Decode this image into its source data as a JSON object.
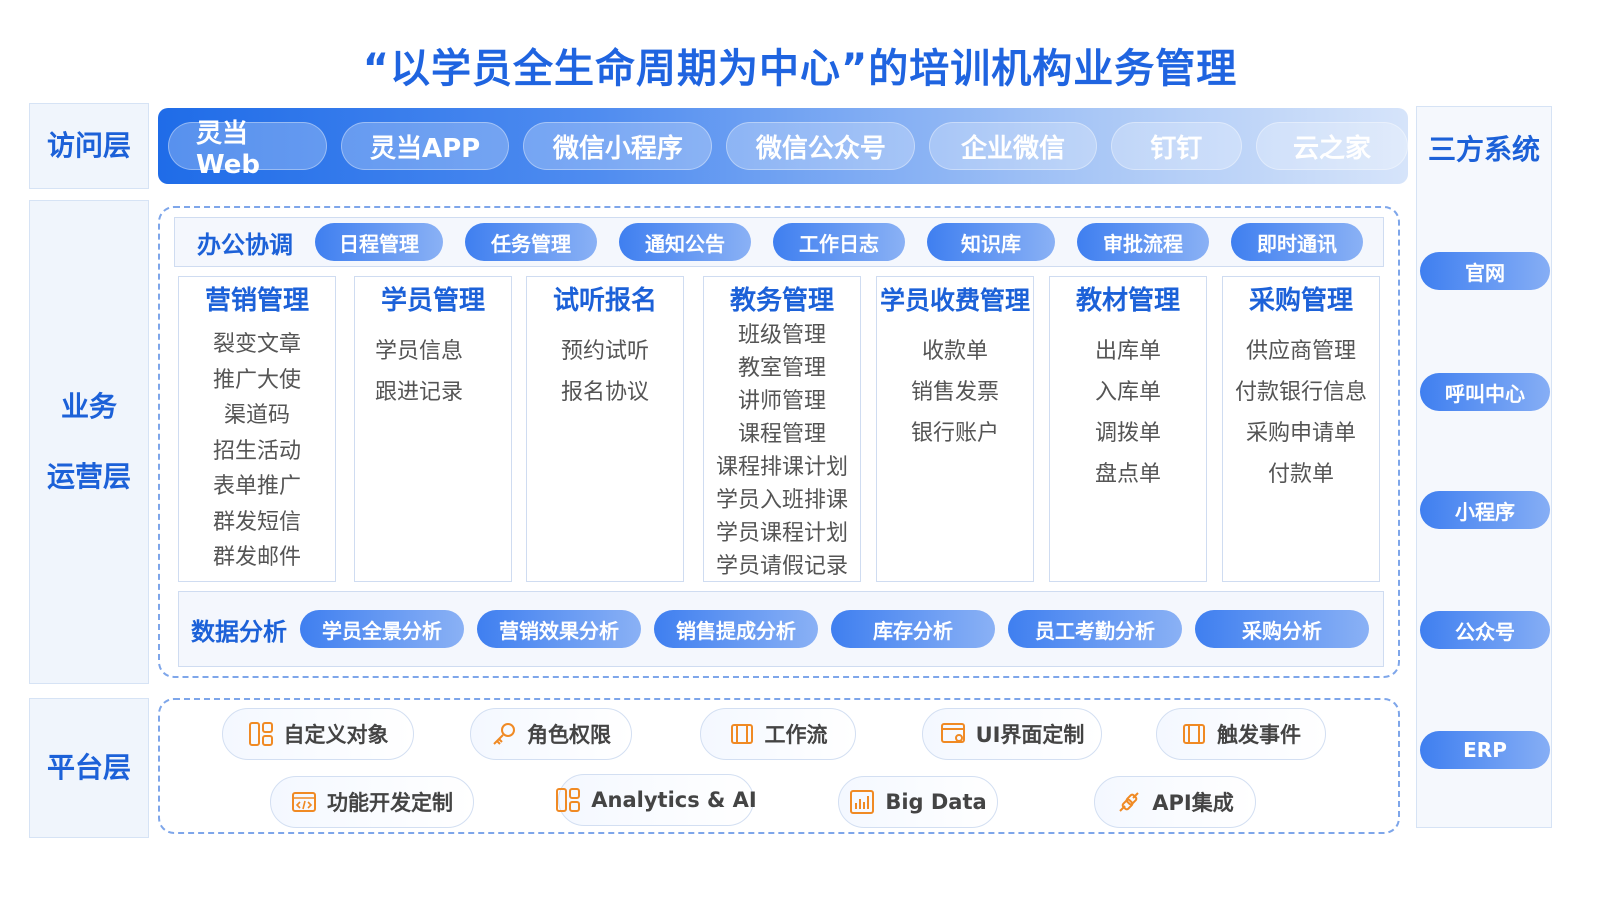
{
  "title": "“以学员全生命周期为中心”的培训机构业务管理",
  "layers": {
    "access": "访问层",
    "business_1": "业务",
    "business_2": "运营层",
    "platform": "平台层"
  },
  "access_items": [
    "灵当Web",
    "灵当APP",
    "微信小程序",
    "微信公众号",
    "企业微信",
    "钉钉",
    "云之家"
  ],
  "office": {
    "title": "办公协调",
    "items": [
      "日程管理",
      "任务管理",
      "通知公告",
      "工作日志",
      "知识库",
      "审批流程",
      "即时通讯"
    ]
  },
  "modules": [
    {
      "title": "营销管理",
      "items": [
        "裂变文章",
        "推广大使",
        "渠道码",
        "招生活动",
        "表单推广",
        "群发短信",
        "群发邮件"
      ]
    },
    {
      "title": "学员管理",
      "items": [
        "学员信息",
        "跟进记录"
      ]
    },
    {
      "title": "试听报名",
      "items": [
        "预约试听",
        "报名协议"
      ]
    },
    {
      "title": "教务管理",
      "items": [
        "班级管理",
        "教室管理",
        "讲师管理",
        "课程管理",
        "课程排课计划",
        "学员入班排课",
        "学员课程计划",
        "学员请假记录"
      ]
    },
    {
      "title": "学员收费管理",
      "items": [
        "收款单",
        "销售发票",
        "银行账户"
      ]
    },
    {
      "title": "教材管理",
      "items": [
        "出库单",
        "入库单",
        "调拨单",
        "盘点单"
      ]
    },
    {
      "title": "采购管理",
      "items": [
        "供应商管理",
        "付款银行信息",
        "采购申请单",
        "付款单"
      ]
    }
  ],
  "analysis": {
    "title": "数据分析",
    "items": [
      "学员全景分析",
      "营销效果分析",
      "销售提成分析",
      "库存分析",
      "员工考勤分析",
      "采购分析"
    ]
  },
  "platform": {
    "row1": [
      {
        "label": "自定义对象",
        "icon": "custom-object-icon"
      },
      {
        "label": "角色权限",
        "icon": "key-icon"
      },
      {
        "label": "工作流",
        "icon": "workflow-icon"
      },
      {
        "label": "UI界面定制",
        "icon": "ui-custom-icon"
      },
      {
        "label": "触发事件",
        "icon": "trigger-icon"
      }
    ],
    "row2": [
      {
        "label": "功能开发定制",
        "icon": "code-icon"
      },
      {
        "label": "Analytics & AI",
        "icon": "analytics-icon"
      },
      {
        "label": "Big Data",
        "icon": "bigdata-icon"
      },
      {
        "label": "API集成",
        "icon": "plug-icon"
      }
    ]
  },
  "third_party": {
    "title": "三方系统",
    "items": [
      "官网",
      "呼叫中心",
      "小程序",
      "公众号",
      "ERP"
    ]
  },
  "colors": {
    "primary": "#1c61d8",
    "accent": "#1f6ce8",
    "border": "#7ea6ea",
    "icon_orange": "#f08a24"
  }
}
